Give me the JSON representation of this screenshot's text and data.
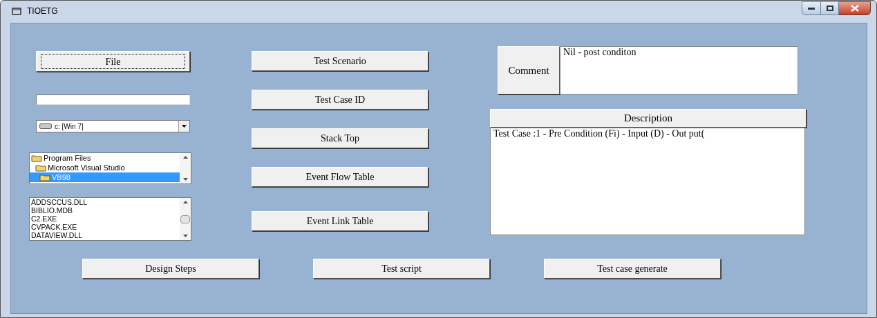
{
  "window": {
    "title": "TIOETG"
  },
  "file_button": {
    "label": "File",
    "focused": true
  },
  "drive_combo": {
    "value": "c: [Win 7]"
  },
  "dir_list": {
    "items": [
      {
        "label": "Program Files",
        "selected": false
      },
      {
        "label": "Microsoft Visual Studio",
        "selected": false
      },
      {
        "label": "VB98",
        "selected": true
      }
    ]
  },
  "file_list": {
    "items": [
      "ADDSCCUS.DLL",
      "BIBLIO.MDB",
      "C2.EXE",
      "CVPACK.EXE",
      "DATAVIEW.DLL"
    ]
  },
  "middle_buttons": [
    "Test Scenario",
    "Test Case ID",
    "Stack Top",
    "Event Flow Table",
    "Event Link Table"
  ],
  "comment": {
    "label": "Comment",
    "value": "Nil - post conditon"
  },
  "description": {
    "header": "Description",
    "value": "Test Case :1 - Pre Condition (Fi) - Input (D) - Out put("
  },
  "bottom_buttons": [
    "Design Steps",
    "Test script",
    "Test case generate"
  ]
}
